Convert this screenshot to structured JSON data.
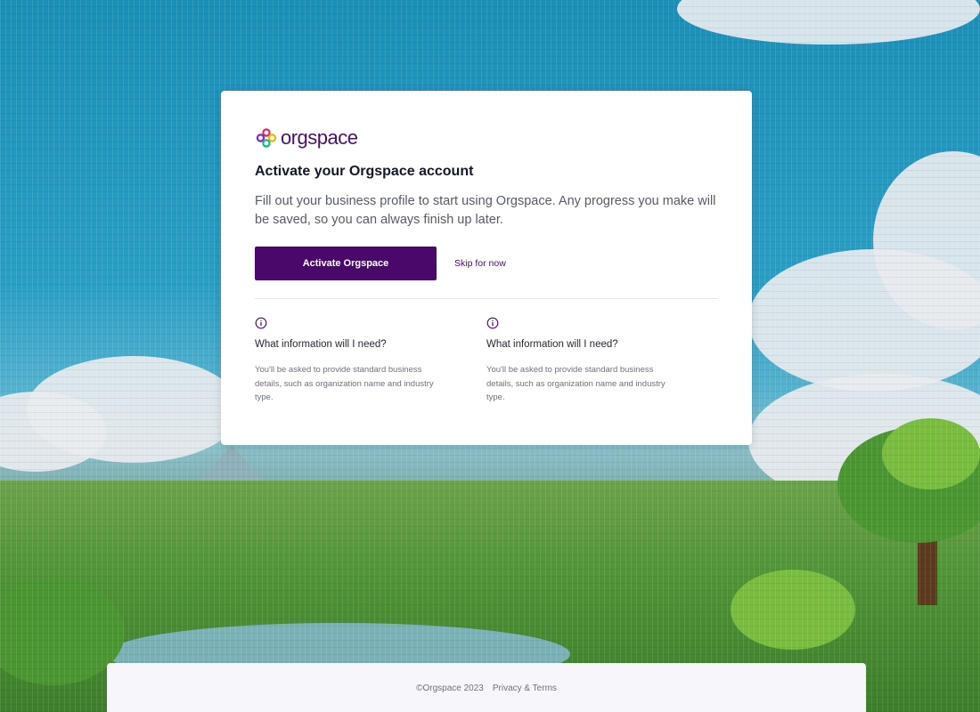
{
  "brand": {
    "logo_text": "orgspace",
    "colors": {
      "primary": "#4b086b",
      "logo_red": "#e0245e",
      "logo_yellow": "#f5b301",
      "logo_green": "#12b886",
      "logo_purple": "#7b2cbf"
    }
  },
  "card": {
    "title": "Activate your Orgspace account",
    "description": "Fill out your business profile to start using Orgspace. Any progress you make will be saved, so you can always finish up later.",
    "primary_button": "Activate Orgspace",
    "skip_link": "Skip for now",
    "info": [
      {
        "icon": "info-icon",
        "title": "What information will I need?",
        "text": "You'll be asked to provide standard business details, such as organization name and industry type."
      },
      {
        "icon": "info-icon",
        "title": "What information will I need?",
        "text": "You'll be asked to provide standard business details, such as organization name and industry type."
      }
    ]
  },
  "footer": {
    "copyright": "©Orgspace 2023",
    "privacy_link": "Privacy & Terms"
  }
}
